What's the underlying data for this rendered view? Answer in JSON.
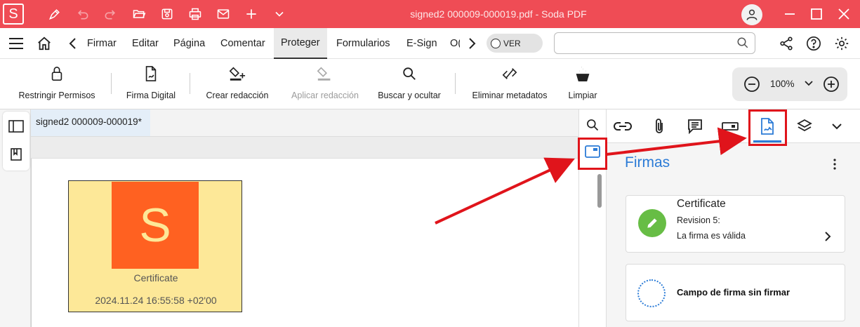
{
  "titlebar": {
    "logo_letter": "S",
    "title": "signed2 000009-000019.pdf   -   Soda PDF",
    "icons": [
      "pen-icon",
      "undo-icon",
      "redo-icon",
      "open-folder-icon",
      "save-icon",
      "print-icon",
      "mail-icon",
      "plus-icon",
      "chevron-down-icon"
    ],
    "bg_color": "#ef4c55"
  },
  "menu": {
    "items": [
      "Firmar",
      "Editar",
      "Página",
      "Comentar",
      "Proteger",
      "Formularios",
      "E-Sign",
      "O("
    ],
    "active": "Proteger",
    "ver_label": "VER",
    "search_placeholder": ""
  },
  "toolbar": {
    "tools": [
      {
        "label": "Restringir Permisos",
        "icon": "lock-icon",
        "enabled": true
      },
      {
        "label": "Firma Digital",
        "icon": "signature-doc-icon",
        "enabled": true
      },
      {
        "label": "Crear redacción",
        "icon": "redaction-add-icon",
        "enabled": true
      },
      {
        "label": "Aplicar redacción",
        "icon": "redaction-apply-icon",
        "enabled": false
      },
      {
        "label": "Buscar y ocultar",
        "icon": "search-icon",
        "enabled": true
      },
      {
        "label": "Eliminar metadatos",
        "icon": "remove-metadata-icon",
        "enabled": true
      },
      {
        "label": "Limpiar",
        "icon": "clean-icon",
        "enabled": true
      }
    ],
    "zoom": "100%"
  },
  "document": {
    "tab_name": "signed2 000009-000019*",
    "signature": {
      "logo_letter": "S",
      "label": "Certificate",
      "date": "2024.11.24 16:55:58 +02'00"
    }
  },
  "panel": {
    "title": "Firmas",
    "tabs": [
      "link-icon",
      "attachment-icon",
      "comments-icon",
      "form-field-icon",
      "signatures-icon",
      "layers-icon",
      "chevron-down-icon"
    ],
    "active_tab": "signatures-icon",
    "signatures": [
      {
        "title": "Certificate",
        "revision": "Revision 5:",
        "status": "La firma es válida"
      },
      {
        "title": "Campo de firma sin firmar"
      }
    ]
  },
  "colors": {
    "accent_blue": "#2b7bd6",
    "valid_green": "#67bd45",
    "highlight_red": "#e0141b",
    "sig_bg": "#fde898",
    "sig_logo": "#ff6121"
  }
}
